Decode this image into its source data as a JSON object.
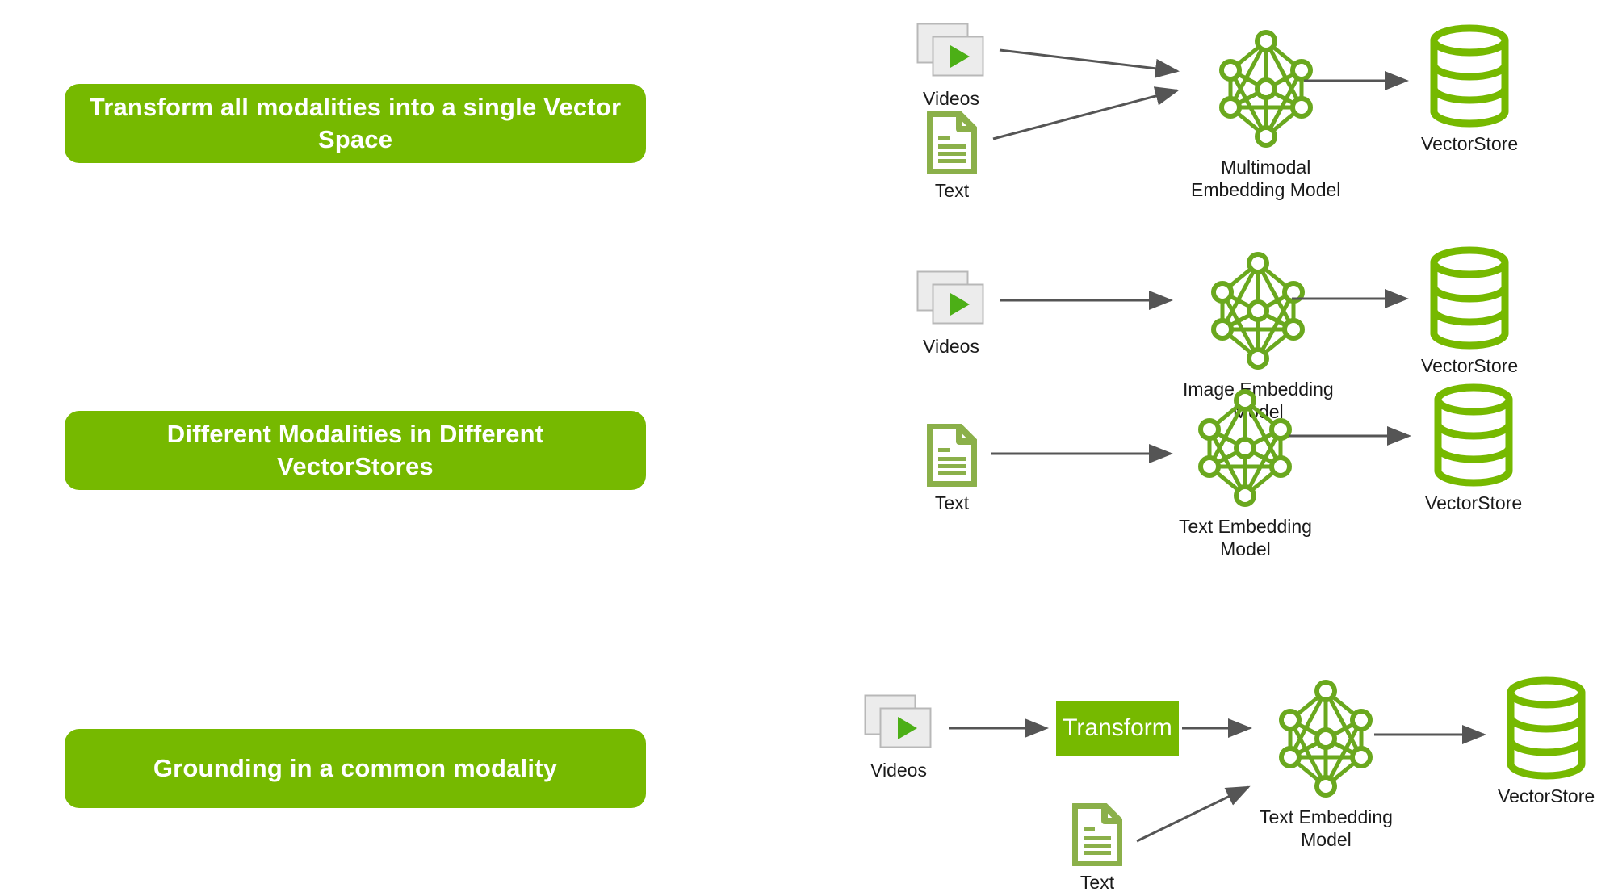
{
  "theme": {
    "brand_green": "#76b900",
    "icon_green": "#8bb04a",
    "arrow_gray": "#555555",
    "text_black": "#1a1a1a",
    "background": "#ffffff"
  },
  "banners": [
    {
      "id": "banner-1",
      "text": "Transform all modalities into a single Vector Space"
    },
    {
      "id": "banner-2",
      "text": "Different Modalities in Different VectorStores"
    },
    {
      "id": "banner-3",
      "text": "Grounding in a common modality"
    }
  ],
  "rows": [
    {
      "id": "row-1",
      "nodes": {
        "videos": "Videos",
        "text": "Text",
        "model": "Multimodal\nEmbedding Model",
        "store": "VectorStore"
      }
    },
    {
      "id": "row-2a",
      "nodes": {
        "videos": "Videos",
        "model": "Image Embedding\nModel",
        "store": "VectorStore"
      }
    },
    {
      "id": "row-2b",
      "nodes": {
        "text": "Text",
        "model": "Text Embedding\nModel",
        "store": "VectorStore"
      }
    },
    {
      "id": "row-3",
      "nodes": {
        "videos": "Videos",
        "transform": "Transform",
        "text": "Text",
        "model": "Text Embedding\nModel",
        "store": "VectorStore"
      }
    }
  ],
  "icons": {
    "video": "video-stack-icon",
    "document": "text-document-icon",
    "network": "neural-network-icon",
    "database": "vectorstore-cylinder-icon",
    "arrow": "arrow-right-icon"
  }
}
